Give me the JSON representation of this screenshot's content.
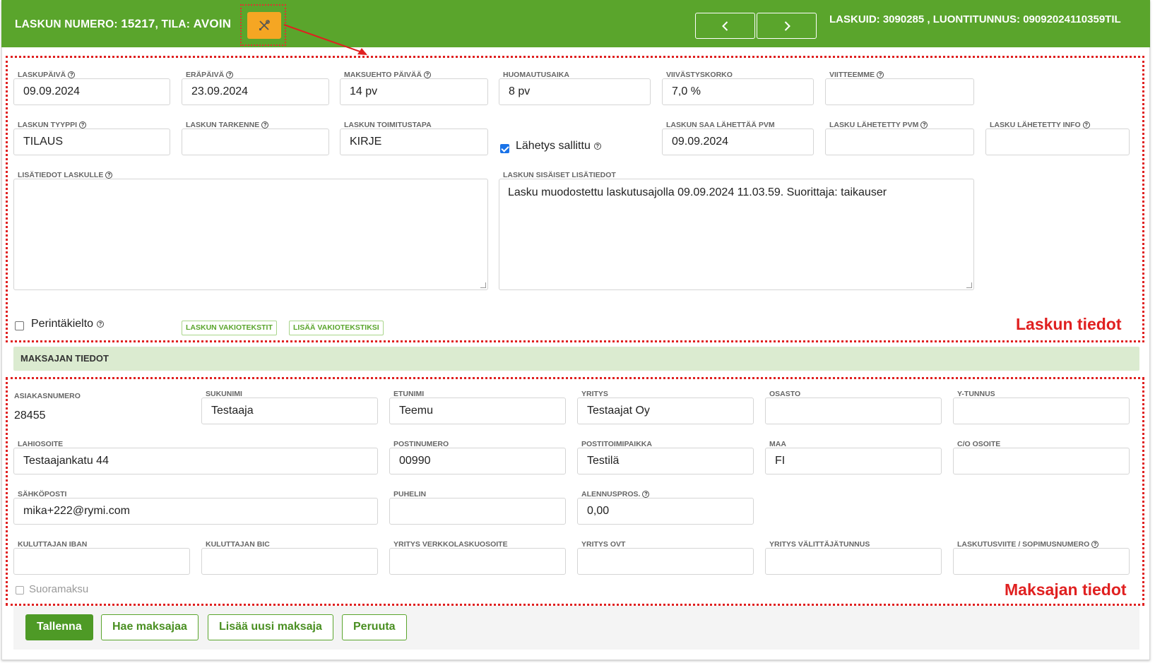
{
  "header": {
    "title_prefix": "LASKUN NUMERO: ",
    "invoice_number": "15217",
    "status_prefix": ", TILA: ",
    "status": "AVOIN",
    "ids": "LASKUID: 3090285 , LUONTITUNNUS: 09092024110359TIL",
    "tool_icon": "wrench-screwdriver-icon",
    "prev_icon": "chevron-left-icon",
    "next_icon": "chevron-right-icon"
  },
  "invoice": {
    "section_label": "Laskun tiedot",
    "laskupaiva": {
      "label": "LASKUPÄIVÄ",
      "value": "09.09.2024"
    },
    "erapaiva": {
      "label": "ERÄPÄIVÄ",
      "value": "23.09.2024"
    },
    "maksuehto": {
      "label": "MAKSUEHTO PÄIVÄÄ",
      "value": "14 pv"
    },
    "huomautusaika": {
      "label": "HUOMAUTUSAIKA",
      "value": "8 pv"
    },
    "viivastyskorko": {
      "label": "VIIVÄSTYSKORKO",
      "value": "7,0 %"
    },
    "viitteemme": {
      "label": "VIITTEEMME",
      "value": ""
    },
    "tyyppi": {
      "label": "LASKUN TYYPPI",
      "value": "TILAUS"
    },
    "tarkenne": {
      "label": "LASKUN TARKENNE",
      "value": ""
    },
    "toimitustapa": {
      "label": "LASKUN TOIMITUSTAPA",
      "value": "KIRJE"
    },
    "lahetys_sallittu": {
      "label": "Lähetys sallittu",
      "checked": true
    },
    "saa_lahettaa": {
      "label": "LASKUN SAA LÄHETTÄÄ PVM",
      "value": "09.09.2024"
    },
    "lahetetty_pvm": {
      "label": "LASKU LÄHETETTY PVM",
      "value": ""
    },
    "lahetetty_info": {
      "label": "LASKU LÄHETETTY INFO",
      "value": ""
    },
    "lisatiedot": {
      "label": "LISÄTIEDOT LASKULLE",
      "value": ""
    },
    "sisaiset": {
      "label": "LASKUN SISÄISET LISÄTIEDOT",
      "value": "Lasku muodostettu laskutusajolla 09.09.2024 11.03.59. Suorittaja: taikauser"
    },
    "perintakielto": {
      "label": "Perintäkielto",
      "checked": false
    },
    "vakiotekstit_btn": "LASKUN VAKIOTEKSTIT",
    "lisaa_vakio_btn": "LISÄÄ VAKIOTEKSTIKSI"
  },
  "payer": {
    "band_title": "MAKSAJAN TIEDOT",
    "section_label": "Maksajan tiedot",
    "asiakasnumero": {
      "label": "ASIAKASNUMERO",
      "value": "28455"
    },
    "sukunimi": {
      "label": "SUKUNIMI",
      "value": "Testaaja"
    },
    "etunimi": {
      "label": "ETUNIMI",
      "value": "Teemu"
    },
    "yritys": {
      "label": "YRITYS",
      "value": "Testaajat Oy"
    },
    "osasto": {
      "label": "OSASTO",
      "value": ""
    },
    "ytunnus": {
      "label": "Y-TUNNUS",
      "value": ""
    },
    "lahiosoite": {
      "label": "LAHIOSOITE",
      "value": "Testaajankatu 44"
    },
    "postinumero": {
      "label": "POSTINUMERO",
      "value": "00990"
    },
    "postitoimipaikka": {
      "label": "POSTITOIMIPAIKKA",
      "value": "Testilä"
    },
    "maa": {
      "label": "MAA",
      "value": "FI"
    },
    "co_osoite": {
      "label": "C/O OSOITE",
      "value": ""
    },
    "sahkoposti": {
      "label": "SÄHKÖPOSTI",
      "value": "mika+222@rymi.com"
    },
    "puhelin": {
      "label": "PUHELIN",
      "value": ""
    },
    "alennuspros": {
      "label": "ALENNUSPROS.",
      "value": "0,00"
    },
    "iban": {
      "label": "KULUTTAJAN IBAN",
      "value": ""
    },
    "bic": {
      "label": "KULUTTAJAN BIC",
      "value": ""
    },
    "verkkolaskuosoite": {
      "label": "YRITYS VERKKOLASKUOSOITE",
      "value": ""
    },
    "ovt": {
      "label": "YRITYS OVT",
      "value": ""
    },
    "valittajatunnus": {
      "label": "YRITYS VÄLITTÄJÄTUNNUS",
      "value": ""
    },
    "laskutusviite": {
      "label": "LASKUTUSVIITE / SOPIMUSNUMERO",
      "value": ""
    },
    "suoramaksu": {
      "label": "Suoramaksu",
      "checked": false
    }
  },
  "footer": {
    "save": "Tallenna",
    "fetch_payer": "Hae maksajaa",
    "add_payer": "Lisää uusi maksaja",
    "cancel": "Peruuta"
  },
  "colors": {
    "brand_green": "#5aa52c",
    "tool_orange": "#f5a623",
    "annotation_red": "#e02020",
    "band_green": "#dbebd0"
  }
}
